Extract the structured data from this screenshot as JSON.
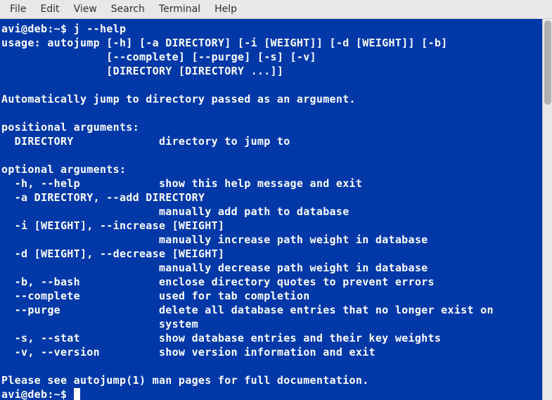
{
  "menu": {
    "items": [
      "File",
      "Edit",
      "View",
      "Search",
      "Terminal",
      "Help"
    ]
  },
  "terminal": {
    "prompt1": "avi@deb:~$ ",
    "command": "j --help",
    "output_lines": [
      "usage: autojump [-h] [-a DIRECTORY] [-i [WEIGHT]] [-d [WEIGHT]] [-b]",
      "                [--complete] [--purge] [-s] [-v]",
      "                [DIRECTORY [DIRECTORY ...]]",
      "",
      "Automatically jump to directory passed as an argument.",
      "",
      "positional arguments:",
      "  DIRECTORY             directory to jump to",
      "",
      "optional arguments:",
      "  -h, --help            show this help message and exit",
      "  -a DIRECTORY, --add DIRECTORY",
      "                        manually add path to database",
      "  -i [WEIGHT], --increase [WEIGHT]",
      "                        manually increase path weight in database",
      "  -d [WEIGHT], --decrease [WEIGHT]",
      "                        manually decrease path weight in database",
      "  -b, --bash            enclose directory quotes to prevent errors",
      "  --complete            used for tab completion",
      "  --purge               delete all database entries that no longer exist on",
      "                        system",
      "  -s, --stat            show database entries and their key weights",
      "  -v, --version         show version information and exit",
      "",
      "Please see autojump(1) man pages for full documentation."
    ],
    "prompt2": "avi@deb:~$ "
  }
}
